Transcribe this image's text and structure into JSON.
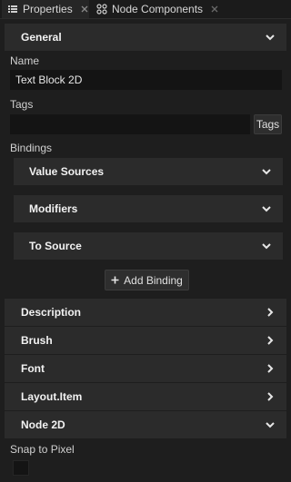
{
  "tabs": [
    {
      "label": "Properties",
      "icon": "list-icon"
    },
    {
      "label": "Node Components",
      "icon": "node-components-icon"
    }
  ],
  "general": {
    "title": "General",
    "name_label": "Name",
    "name_value": "Text Block 2D",
    "tags_label": "Tags",
    "tags_value": "",
    "tags_button": "Tags",
    "bindings_label": "Bindings",
    "bindings": [
      {
        "label": "Value Sources"
      },
      {
        "label": "Modifiers"
      },
      {
        "label": "To Source"
      }
    ],
    "add_binding_label": "Add Binding"
  },
  "collapsed_sections": [
    {
      "label": "Description"
    },
    {
      "label": "Brush"
    },
    {
      "label": "Font"
    },
    {
      "label": "Layout.Item"
    }
  ],
  "node2d": {
    "title": "Node 2D",
    "snap_label": "Snap to Pixel",
    "snap_checked": false
  }
}
